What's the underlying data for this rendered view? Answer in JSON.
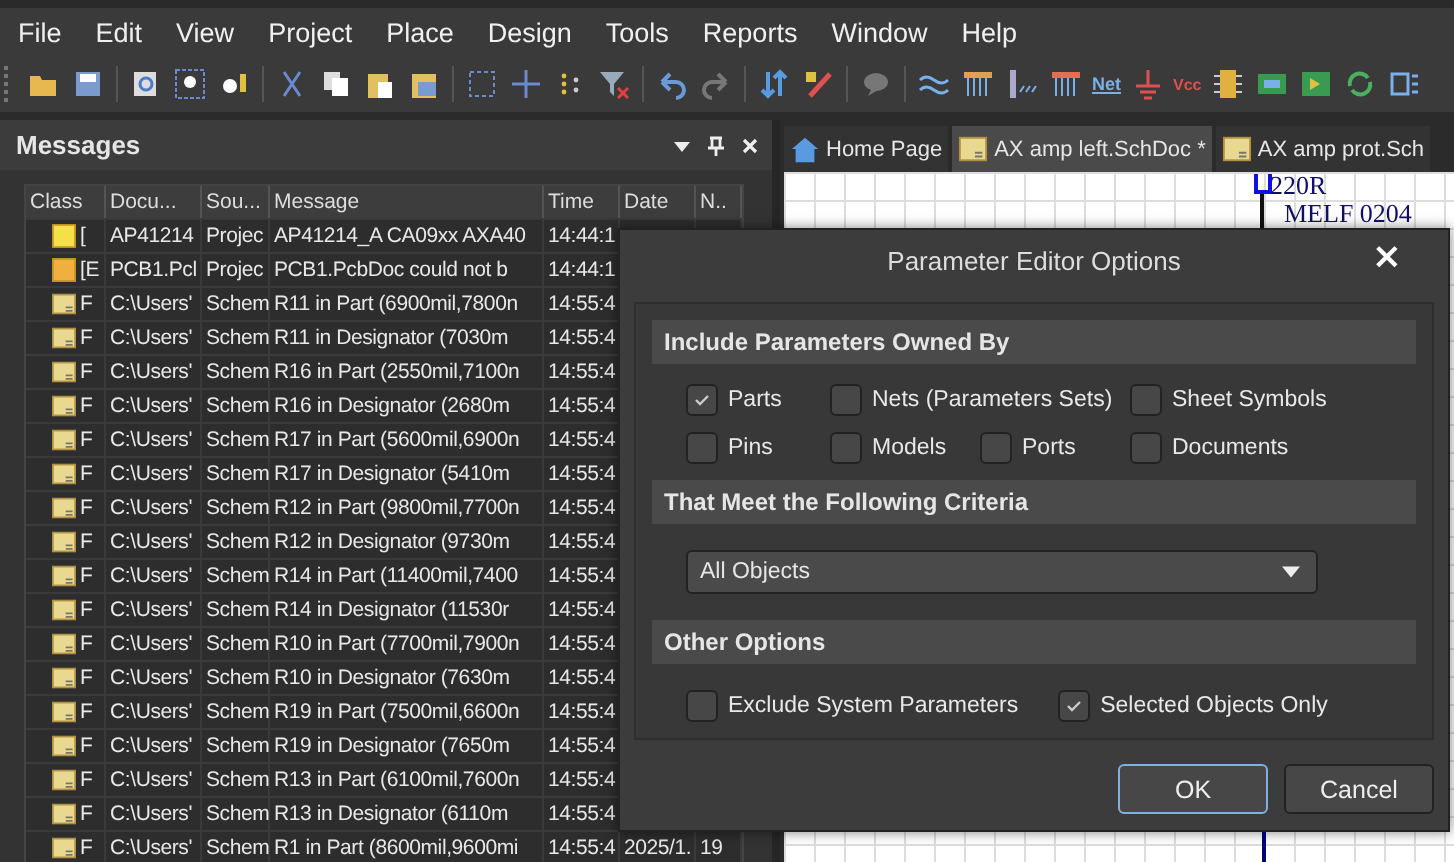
{
  "menu": [
    {
      "label": "File"
    },
    {
      "label": "Edit"
    },
    {
      "label": "View"
    },
    {
      "label": "Project"
    },
    {
      "label": "Place"
    },
    {
      "label": "Design"
    },
    {
      "label": "Tools"
    },
    {
      "label": "Reports"
    },
    {
      "label": "Window"
    },
    {
      "label": "Help"
    }
  ],
  "toolbar": {
    "net_label": "Net",
    "vcc_label": "Vcc"
  },
  "messages": {
    "title": "Messages",
    "columns": [
      "Class",
      "Docu...",
      "Sou...",
      "Message",
      "Time",
      "Date",
      "N.."
    ],
    "rows": [
      {
        "kind": "warning",
        "class": "[",
        "document": "AP41214",
        "source": "Projec",
        "message": "AP41214_A CA09xx AXA40",
        "time": "14:44:1"
      },
      {
        "kind": "error",
        "class": "[E",
        "document": "PCB1.Pcl",
        "source": "Projec",
        "message": "PCB1.PcbDoc could not b",
        "time": "14:44:1"
      },
      {
        "kind": "info",
        "class": "F",
        "document": "C:\\Users'",
        "source": "Schem",
        "message": "R11 in Part (6900mil,7800n",
        "time": "14:55:4"
      },
      {
        "kind": "info",
        "class": "F",
        "document": "C:\\Users'",
        "source": "Schem",
        "message": "R11 in Designator (7030m",
        "time": "14:55:4"
      },
      {
        "kind": "info",
        "class": "F",
        "document": "C:\\Users'",
        "source": "Schem",
        "message": "R16 in Part (2550mil,7100n",
        "time": "14:55:4"
      },
      {
        "kind": "info",
        "class": "F",
        "document": "C:\\Users'",
        "source": "Schem",
        "message": "R16 in Designator (2680m",
        "time": "14:55:4"
      },
      {
        "kind": "info",
        "class": "F",
        "document": "C:\\Users'",
        "source": "Schem",
        "message": "R17 in Part (5600mil,6900n",
        "time": "14:55:4"
      },
      {
        "kind": "info",
        "class": "F",
        "document": "C:\\Users'",
        "source": "Schem",
        "message": "R17 in Designator (5410m",
        "time": "14:55:4"
      },
      {
        "kind": "info",
        "class": "F",
        "document": "C:\\Users'",
        "source": "Schem",
        "message": "R12 in Part (9800mil,7700n",
        "time": "14:55:4"
      },
      {
        "kind": "info",
        "class": "F",
        "document": "C:\\Users'",
        "source": "Schem",
        "message": "R12 in Designator (9730m",
        "time": "14:55:4"
      },
      {
        "kind": "info",
        "class": "F",
        "document": "C:\\Users'",
        "source": "Schem",
        "message": "R14 in Part (11400mil,7400",
        "time": "14:55:4"
      },
      {
        "kind": "info",
        "class": "F",
        "document": "C:\\Users'",
        "source": "Schem",
        "message": "R14 in Designator (11530r",
        "time": "14:55:4"
      },
      {
        "kind": "info",
        "class": "F",
        "document": "C:\\Users'",
        "source": "Schem",
        "message": "R10 in Part (7700mil,7900n",
        "time": "14:55:4"
      },
      {
        "kind": "info",
        "class": "F",
        "document": "C:\\Users'",
        "source": "Schem",
        "message": "R10 in Designator (7630m",
        "time": "14:55:4"
      },
      {
        "kind": "info",
        "class": "F",
        "document": "C:\\Users'",
        "source": "Schem",
        "message": "R19 in Part (7500mil,6600n",
        "time": "14:55:4"
      },
      {
        "kind": "info",
        "class": "F",
        "document": "C:\\Users'",
        "source": "Schem",
        "message": "R19 in Designator (7650m",
        "time": "14:55:4"
      },
      {
        "kind": "info",
        "class": "F",
        "document": "C:\\Users'",
        "source": "Schem",
        "message": "R13 in Part (6100mil,7600n",
        "time": "14:55:4"
      },
      {
        "kind": "info",
        "class": "F",
        "document": "C:\\Users'",
        "source": "Schem",
        "message": "R13 in Designator (6110m",
        "time": "14:55:4"
      },
      {
        "kind": "info",
        "class": "F",
        "document": "C:\\Users'",
        "source": "Schem",
        "message": "R1 in Part (8600mil,9600mi",
        "time": "14:55:4",
        "date": "2025/1.",
        "number": "19"
      }
    ]
  },
  "tabs": [
    {
      "label": "Home Page",
      "kind": "home",
      "selected": false
    },
    {
      "label": "AX amp left.SchDoc *",
      "kind": "doc",
      "selected": true
    },
    {
      "label": "AX amp prot.Sch",
      "kind": "doc",
      "selected": false
    }
  ],
  "schematic": {
    "value": "220R",
    "footprint": "MELF 0204"
  },
  "dialog": {
    "title": "Parameter Editor Options",
    "close": "×",
    "sections": [
      {
        "kind": "checks",
        "title": "Include Parameters Owned By",
        "options": [
          {
            "label": "Parts",
            "checked": true
          },
          {
            "label": "Nets (Parameters Sets)",
            "checked": false
          },
          {
            "label": "Sheet Symbols",
            "checked": false
          },
          {
            "label": "Pins",
            "checked": false
          },
          {
            "label": "Models",
            "checked": false
          },
          {
            "label": "Ports",
            "checked": false
          },
          {
            "label": "Documents",
            "checked": false
          }
        ]
      },
      {
        "kind": "dropdown",
        "title": "That Meet the Following Criteria",
        "value": "All Objects"
      },
      {
        "kind": "checks",
        "title": "Other Options",
        "options": [
          {
            "label": "Exclude System Parameters",
            "checked": false
          },
          {
            "label": "Selected Objects Only",
            "checked": true
          }
        ]
      }
    ],
    "buttons": [
      {
        "label": "OK",
        "kind": "default"
      },
      {
        "label": "Cancel",
        "kind": "normal"
      }
    ]
  }
}
